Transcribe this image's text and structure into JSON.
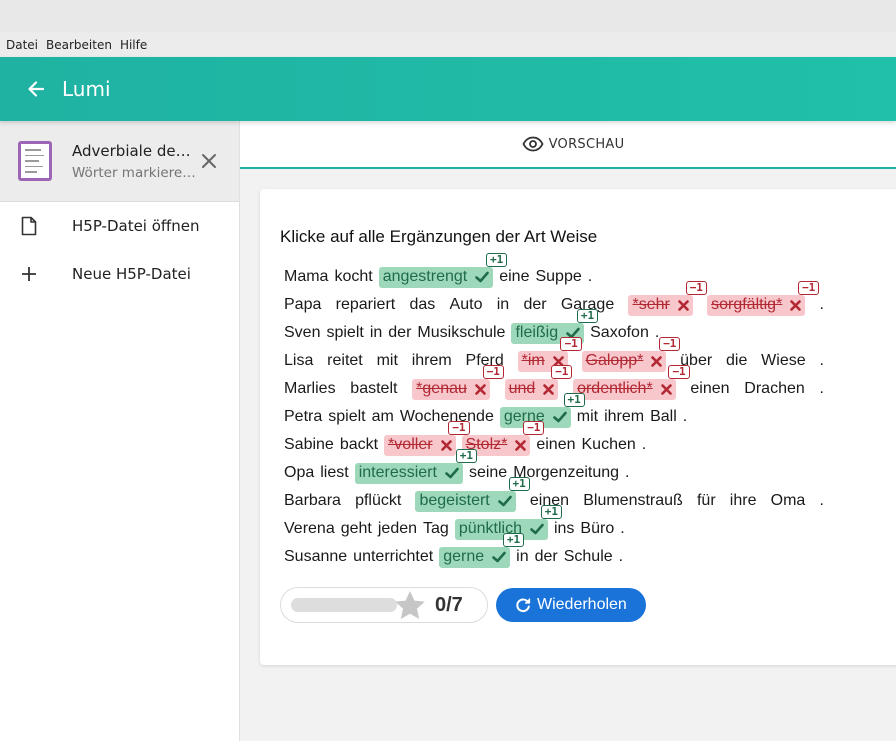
{
  "menu": [
    "Datei",
    "Bearbeiten",
    "Hilfe"
  ],
  "appbar": {
    "title": "Lumi"
  },
  "sidebar": {
    "file": {
      "title": "Adverbiale de…",
      "subtitle": "Wörter markiere…"
    },
    "actions": [
      {
        "label": "H5P-Datei öffnen",
        "icon": "file-icon"
      },
      {
        "label": "Neue H5P-Datei",
        "icon": "plus-icon"
      }
    ]
  },
  "tabs": {
    "preview": "VORSCHAU"
  },
  "task": {
    "question": "Klicke auf alle Ergänzungen der Art Weise",
    "score": "0/7",
    "progress_fraction": 0,
    "retry_label": "Wiederholen",
    "correct_badge": "+1",
    "wrong_badge": "−1"
  },
  "sentences": [
    [
      {
        "t": "Mama"
      },
      {
        "t": "kocht"
      },
      {
        "t": "angestrengt",
        "s": "ok"
      },
      {
        "t": "eine"
      },
      {
        "t": "Suppe"
      },
      {
        "t": "."
      }
    ],
    [
      {
        "t": "Papa"
      },
      {
        "t": "repariert"
      },
      {
        "t": "das"
      },
      {
        "t": "Auto"
      },
      {
        "t": "in"
      },
      {
        "t": "der"
      },
      {
        "t": "Garage"
      },
      {
        "t": "*sehr",
        "s": "bad"
      },
      {
        "t": "sorgfältig*",
        "s": "bad"
      },
      {
        "t": "."
      }
    ],
    [
      {
        "t": "Sven"
      },
      {
        "t": "spielt"
      },
      {
        "t": "in"
      },
      {
        "t": "der"
      },
      {
        "t": "Musikschule"
      },
      {
        "t": "fleißig",
        "s": "ok"
      },
      {
        "t": "Saxofon"
      },
      {
        "t": "."
      }
    ],
    [
      {
        "t": "Lisa"
      },
      {
        "t": "reitet"
      },
      {
        "t": "mit"
      },
      {
        "t": "ihrem"
      },
      {
        "t": "Pferd"
      },
      {
        "t": "*im",
        "s": "bad"
      },
      {
        "t": "Galopp*",
        "s": "bad"
      },
      {
        "t": "über"
      },
      {
        "t": "die"
      },
      {
        "t": "Wiese"
      },
      {
        "t": "."
      }
    ],
    [
      {
        "t": "Marlies"
      },
      {
        "t": "bastelt"
      },
      {
        "t": "*genau",
        "s": "bad"
      },
      {
        "t": "und",
        "s": "bad"
      },
      {
        "t": "ordentlich*",
        "s": "bad"
      },
      {
        "t": "einen"
      },
      {
        "t": "Drachen"
      },
      {
        "t": "."
      }
    ],
    [
      {
        "t": "Petra"
      },
      {
        "t": "spielt"
      },
      {
        "t": "am"
      },
      {
        "t": "Wochenende"
      },
      {
        "t": "gerne",
        "s": "ok"
      },
      {
        "t": "mit"
      },
      {
        "t": "ihrem"
      },
      {
        "t": "Ball"
      },
      {
        "t": "."
      }
    ],
    [
      {
        "t": "Sabine"
      },
      {
        "t": "backt"
      },
      {
        "t": "*voller",
        "s": "bad"
      },
      {
        "t": "Stolz*",
        "s": "bad"
      },
      {
        "t": "einen"
      },
      {
        "t": "Kuchen"
      },
      {
        "t": "."
      }
    ],
    [
      {
        "t": "Opa"
      },
      {
        "t": "liest"
      },
      {
        "t": "interessiert",
        "s": "ok"
      },
      {
        "t": "seine"
      },
      {
        "t": "Morgenzeitung"
      },
      {
        "t": "."
      }
    ],
    [
      {
        "t": "Barbara"
      },
      {
        "t": "pflückt"
      },
      {
        "t": "begeistert",
        "s": "ok"
      },
      {
        "t": "einen"
      },
      {
        "t": "Blumenstrauß"
      },
      {
        "t": "für"
      },
      {
        "t": "ihre"
      },
      {
        "t": "Oma"
      },
      {
        "t": "."
      }
    ],
    [
      {
        "t": "Verena"
      },
      {
        "t": "geht"
      },
      {
        "t": "jeden"
      },
      {
        "t": "Tag"
      },
      {
        "t": "pünktlich",
        "s": "ok"
      },
      {
        "t": "ins"
      },
      {
        "t": "Büro"
      },
      {
        "t": "."
      }
    ],
    [
      {
        "t": "Susanne"
      },
      {
        "t": "unterrichtet"
      },
      {
        "t": "gerne",
        "s": "ok"
      },
      {
        "t": "in"
      },
      {
        "t": "der"
      },
      {
        "t": "Schule"
      },
      {
        "t": "."
      }
    ]
  ]
}
